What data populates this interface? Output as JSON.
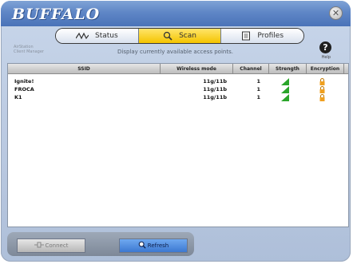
{
  "app": {
    "logo": "BUFFALO",
    "help_label": "Help"
  },
  "tabs": [
    {
      "label": "Status",
      "active": false,
      "icon": "signal-wave-icon"
    },
    {
      "label": "Scan",
      "active": true,
      "icon": "magnifier-icon"
    },
    {
      "label": "Profiles",
      "active": false,
      "icon": "document-icon"
    }
  ],
  "description": "Display currently available access points.",
  "brand_small": {
    "line1": "AirStation",
    "line2": "Client Manager"
  },
  "table": {
    "headers": [
      "SSID",
      "Wireless mode",
      "Channel",
      "Strength",
      "Encryption"
    ],
    "rows": [
      {
        "ssid": "Ignite!",
        "mode": "11g/11b",
        "channel": "1",
        "strength": 0.8,
        "encrypted": true
      },
      {
        "ssid": "FROCA",
        "mode": "11g/11b",
        "channel": "1",
        "strength": 0.8,
        "encrypted": true
      },
      {
        "ssid": "K1",
        "mode": "11g/11b",
        "channel": "1",
        "strength": 0.8,
        "encrypted": true
      }
    ]
  },
  "buttons": {
    "connect": "Connect",
    "refresh": "Refresh"
  },
  "colors": {
    "active_tab": "#f4c400",
    "strength": "#2aa52a",
    "lock": "#f0a020"
  }
}
